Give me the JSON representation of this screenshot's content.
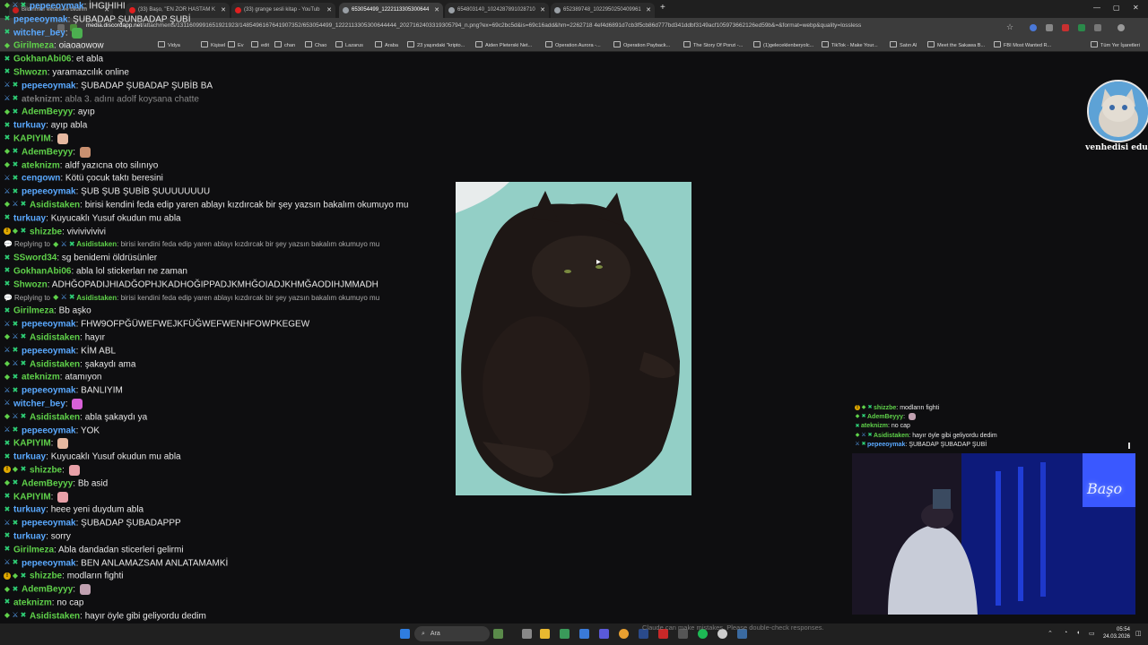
{
  "tabs": [
    {
      "title": "Bildirimler ekranı ve bildirim",
      "color": "#c81e1e",
      "active": false
    },
    {
      "title": "(33) Başo, \"EN ZOR HASTAM K",
      "color": "#e02020",
      "active": false
    },
    {
      "title": "(33) grange sesli kitap - YouTub",
      "color": "#e02020",
      "active": false
    },
    {
      "title": "653054499_1222113305300644",
      "color": "#9aa0a6",
      "active": true
    },
    {
      "title": "654803140_1024287891028710",
      "color": "#9aa0a6",
      "active": false
    },
    {
      "title": "652389748_1022950250409961",
      "color": "#9aa0a6",
      "active": false
    }
  ],
  "address": {
    "host": "media.discordapp.net",
    "path": "/attachments/1311609991651921923/1485496167641907352/653054499_1222113305300644444_2027162403319305794_n.png?ex=69c2bc5d&is=69c16add&hm=2262718 4ef4d6891d7cb3f5cb86d777bd341ddbf3149acf105973662126ed59b&=&format=webp&quality=lossless"
  },
  "bookmarks": [
    "Vidya",
    "Kişisel",
    "Ev",
    "edit",
    "chan",
    "Chao",
    "Lazarus",
    "Araba",
    "23 yaşındaki \"kripto...",
    "Aiden Pleterski Net...",
    "Operation Aurora -...",
    "Operation Payback...",
    "The Story Of Ponzi -...",
    "(1)geleceklenberyolc...",
    "TikTok - Make Your...",
    "Satın Al",
    "Meet the Sakawa B...",
    "FBI Most Wanted R...",
    "Tüm Yer İşaretleri"
  ],
  "chat": [
    {
      "type": "msg",
      "badges": [
        "dmd",
        "sword",
        "mod"
      ],
      "name": "pepeeoymak",
      "color": "#5aa9ff",
      "text": "İHGIHIHI"
    },
    {
      "type": "msg",
      "badges": [
        "mod"
      ],
      "name": "pepeeoymak",
      "color": "#5aa9ff",
      "text": "ŞUBADAP ŞUNBADAP ŞUBİ"
    },
    {
      "type": "msg",
      "badges": [
        "mod"
      ],
      "name": "witcher_bey",
      "color": "#5aa9ff",
      "text": "",
      "emote": "#4caf50"
    },
    {
      "type": "msg",
      "badges": [
        "dmd"
      ],
      "name": "Girilmeza",
      "color": "#5fd14a",
      "text": "oiaoaowow"
    },
    {
      "type": "msg",
      "badges": [
        "mod"
      ],
      "name": "GokhanAbi06",
      "color": "#5fd14a",
      "text": "et abla"
    },
    {
      "type": "msg",
      "badges": [
        "mod"
      ],
      "name": "Shwozn",
      "color": "#5fd14a",
      "text": "yaramazcılık online"
    },
    {
      "type": "msg",
      "badges": [
        "sword",
        "mod"
      ],
      "name": "pepeeoymak",
      "color": "#5aa9ff",
      "text": "ŞUBADAP ŞUBADAP ŞUBİB BA"
    },
    {
      "type": "msg",
      "badges": [
        "sword",
        "mod"
      ],
      "name": "ateknizm",
      "color": "#7a7a7a",
      "text": "abla 3. adını adolf koysana chatte",
      "dim": true
    },
    {
      "type": "msg",
      "badges": [
        "dmd",
        "mod"
      ],
      "name": "AdemBeyyy",
      "color": "#5fd14a",
      "text": "ayıp"
    },
    {
      "type": "msg",
      "badges": [
        "mod"
      ],
      "name": "turkuay",
      "color": "#5aa9ff",
      "text": "ayıp abla"
    },
    {
      "type": "msg",
      "badges": [
        "mod"
      ],
      "name": "KAPIYIM",
      "color": "#5fd14a",
      "text": "",
      "emote": "#e6b8a0"
    },
    {
      "type": "msg",
      "badges": [
        "dmd",
        "mod"
      ],
      "name": "AdemBeyyy",
      "color": "#5fd14a",
      "text": "",
      "emote": "#c99070"
    },
    {
      "type": "msg",
      "badges": [
        "dmd",
        "mod"
      ],
      "name": "ateknizm",
      "color": "#5fd14a",
      "text": "aldf yazıcna oto silınıyo"
    },
    {
      "type": "msg",
      "badges": [
        "sword",
        "mod"
      ],
      "name": "cengown",
      "color": "#5aa9ff",
      "text": "Kötü çocuk taktı beresini"
    },
    {
      "type": "msg",
      "badges": [
        "sword",
        "mod"
      ],
      "name": "pepeeoymak",
      "color": "#5aa9ff",
      "text": "ŞUB ŞUB ŞUBİB ŞUUUUUUUU"
    },
    {
      "type": "msg",
      "badges": [
        "dmd",
        "sword",
        "mod"
      ],
      "name": "Asidistaken",
      "color": "#5fd14a",
      "text": "birisi kendini feda edip yaren ablayı kızdırcak bir şey yazsın bakalım okumuyo mu"
    },
    {
      "type": "msg",
      "badges": [
        "mod"
      ],
      "name": "turkuay",
      "color": "#5aa9ff",
      "text": "Kuyucaklı Yusuf okudun mu abla"
    },
    {
      "type": "msg",
      "badges": [
        "ex",
        "dmd",
        "mod"
      ],
      "name": "shizzbe",
      "color": "#5fd14a",
      "text": "vivivivivivi"
    },
    {
      "type": "reply",
      "to": "Asidistaken",
      "text": "birisi kendini feda edip yaren ablayı kızdırcak bir şey yazsın bakalım okumuyo mu"
    },
    {
      "type": "msg",
      "badges": [
        "mod"
      ],
      "name": "SSword34",
      "color": "#5fd14a",
      "text": "sg benidemi öldrüsünler"
    },
    {
      "type": "msg",
      "badges": [
        "mod"
      ],
      "name": "GokhanAbi06",
      "color": "#5fd14a",
      "text": "abla lol stickerları ne zaman"
    },
    {
      "type": "msg",
      "badges": [
        "mod"
      ],
      "name": "Shwozn",
      "color": "#5fd14a",
      "text": "ADHĞOPADIJHIADĞOPHJKADHOĞIPPADJKMHĞOIADJKHMĞAODIHJMMADH"
    },
    {
      "type": "reply",
      "to": "Asidistaken",
      "text": "birisi kendini feda edip yaren ablayı kızdırcak bir şey yazsın bakalım okumuyo mu"
    },
    {
      "type": "msg",
      "badges": [
        "mod"
      ],
      "name": "Girilmeza",
      "color": "#5fd14a",
      "text": "Bb aşko"
    },
    {
      "type": "msg",
      "badges": [
        "sword",
        "mod"
      ],
      "name": "pepeeoymak",
      "color": "#5aa9ff",
      "text": "FHW9OFPĞÜWEFWEJKFÜĞWEFWENHFOWPKEGEW"
    },
    {
      "type": "msg",
      "badges": [
        "dmd",
        "sword",
        "mod"
      ],
      "name": "Asidistaken",
      "color": "#5fd14a",
      "text": "hayır"
    },
    {
      "type": "msg",
      "badges": [
        "sword",
        "mod"
      ],
      "name": "pepeeoymak",
      "color": "#5aa9ff",
      "text": "KİM ABL"
    },
    {
      "type": "msg",
      "badges": [
        "dmd",
        "sword",
        "mod"
      ],
      "name": "Asidistaken",
      "color": "#5fd14a",
      "text": "şakaydı ama"
    },
    {
      "type": "msg",
      "badges": [
        "dmd",
        "mod"
      ],
      "name": "ateknizm",
      "color": "#5fd14a",
      "text": "atamıyon"
    },
    {
      "type": "msg",
      "badges": [
        "sword",
        "mod"
      ],
      "name": "pepeeoymak",
      "color": "#5aa9ff",
      "text": "BANLIYIM"
    },
    {
      "type": "msg",
      "badges": [
        "sword"
      ],
      "name": "witcher_bey",
      "color": "#5aa9ff",
      "text": "",
      "emote": "#d860d8"
    },
    {
      "type": "msg",
      "badges": [
        "dmd",
        "sword",
        "mod"
      ],
      "name": "Asidistaken",
      "color": "#5fd14a",
      "text": "abla şakaydı ya"
    },
    {
      "type": "msg",
      "badges": [
        "sword",
        "mod"
      ],
      "name": "pepeeoymak",
      "color": "#5aa9ff",
      "text": "YOK"
    },
    {
      "type": "msg",
      "badges": [
        "mod"
      ],
      "name": "KAPIYIM",
      "color": "#5fd14a",
      "text": "",
      "emote": "#e6b8a0"
    },
    {
      "type": "msg",
      "badges": [
        "mod"
      ],
      "name": "turkuay",
      "color": "#5aa9ff",
      "text": "Kuyucaklı Yusuf okudun mu abla"
    },
    {
      "type": "msg",
      "badges": [
        "ex",
        "dmd",
        "mod"
      ],
      "name": "shizzbe",
      "color": "#5fd14a",
      "text": "",
      "emote": "#e8a0a8"
    },
    {
      "type": "msg",
      "badges": [
        "dmd",
        "mod"
      ],
      "name": "AdemBeyyy",
      "color": "#5fd14a",
      "text": "Bb asid"
    },
    {
      "type": "msg",
      "badges": [
        "mod"
      ],
      "name": "KAPIYIM",
      "color": "#5fd14a",
      "text": "",
      "emote": "#e8a0a8"
    },
    {
      "type": "msg",
      "badges": [
        "mod"
      ],
      "name": "turkuay",
      "color": "#5aa9ff",
      "text": "heee yeni duydum abla"
    },
    {
      "type": "msg",
      "badges": [
        "sword",
        "mod"
      ],
      "name": "pepeeoymak",
      "color": "#5aa9ff",
      "text": "ŞUBADAP ŞUBADAPPP"
    },
    {
      "type": "msg",
      "badges": [
        "mod"
      ],
      "name": "turkuay",
      "color": "#5aa9ff",
      "text": "sorry"
    },
    {
      "type": "msg",
      "badges": [
        "mod"
      ],
      "name": "Girilmeza",
      "color": "#5fd14a",
      "text": "Abla dandadan sticerleri gelirmi"
    },
    {
      "type": "msg",
      "badges": [
        "sword",
        "mod"
      ],
      "name": "pepeeoymak",
      "color": "#5aa9ff",
      "text": "BEN ANLAMAZSAM ANLATAMAMKİ"
    },
    {
      "type": "msg",
      "badges": [
        "ex",
        "dmd",
        "mod"
      ],
      "name": "shizzbe",
      "color": "#5fd14a",
      "text": "modların fighti"
    },
    {
      "type": "msg",
      "badges": [
        "dmd",
        "mod"
      ],
      "name": "AdemBeyyy",
      "color": "#5fd14a",
      "text": "",
      "emote": "#c0a0b0"
    },
    {
      "type": "msg",
      "badges": [
        "mod"
      ],
      "name": "ateknizm",
      "color": "#5fd14a",
      "text": "no cap"
    },
    {
      "type": "msg",
      "badges": [
        "dmd",
        "sword",
        "mod"
      ],
      "name": "Asidistaken",
      "color": "#5fd14a",
      "text": "hayır öyle gibi geliyordu dedim"
    },
    {
      "type": "msg",
      "badges": [
        "sword",
        "mod"
      ],
      "name": "pepeeoymak",
      "color": "#5aa9ff",
      "text": "ŞUBADAP ŞUBADAP ŞUBİ"
    }
  ],
  "overlay": {
    "avatar_label": "venhedisi edu",
    "mini_chat": [
      {
        "badges": [
          "ex",
          "dmd",
          "mod"
        ],
        "name": "shizzbe",
        "color": "#5fd14a",
        "text": "modların fighti"
      },
      {
        "badges": [
          "dmd",
          "mod"
        ],
        "name": "AdemBeyyy",
        "color": "#5fd14a",
        "text": ""
      },
      {
        "badges": [
          "mod"
        ],
        "name": "ateknizm",
        "color": "#5fd14a",
        "text": "no cap"
      },
      {
        "badges": [
          "dmd",
          "sword",
          "mod"
        ],
        "name": "Asidistaken",
        "color": "#5fd14a",
        "text": "hayır öyle gibi geliyordu dedim"
      },
      {
        "badges": [
          "sword",
          "mod"
        ],
        "name": "pepeeoymak",
        "color": "#5aa9ff",
        "text": "ŞUBADAP ŞUBADAP ŞUBİ"
      }
    ],
    "cam_sign": "Başo"
  },
  "taskbar": {
    "search_label": "Ara",
    "gemini_notice": "Claude can make mistakes. Please double-check responses.",
    "time": "05:54",
    "date": "24.03.2026"
  },
  "window_controls": {
    "min": "—",
    "max": "▢",
    "close": "✕"
  }
}
